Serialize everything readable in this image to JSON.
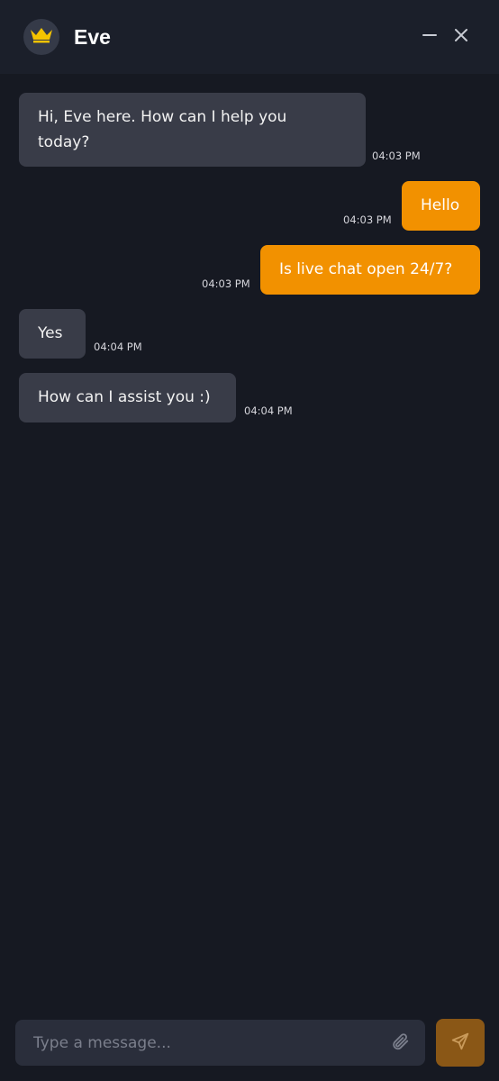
{
  "header": {
    "title": "Eve",
    "avatar_icon": "crown-icon",
    "minimize_icon": "minimize-icon",
    "close_icon": "close-icon"
  },
  "messages": [
    {
      "sender": "bot",
      "lines": [
        "Hi, Eve here. How can I help you",
        "today?"
      ],
      "time": "04:03 PM"
    },
    {
      "sender": "user",
      "text": "Hello",
      "time": "04:03 PM"
    },
    {
      "sender": "user",
      "text": "Is live chat open 24/7?",
      "time": "04:03 PM"
    },
    {
      "sender": "bot",
      "text": "Yes",
      "time": "04:04 PM"
    },
    {
      "sender": "bot",
      "text": "How can I assist you :)",
      "time": "04:04 PM"
    }
  ],
  "composer": {
    "placeholder": "Type a message...",
    "value": "",
    "attach_icon": "paperclip-icon",
    "send_icon": "send-icon"
  },
  "colors": {
    "background": "#161922",
    "header": "#1b1f2a",
    "bot_bubble": "#393c48",
    "user_bubble": "#f29100",
    "send_button": "#8a5716",
    "crown": "#f5c400"
  }
}
